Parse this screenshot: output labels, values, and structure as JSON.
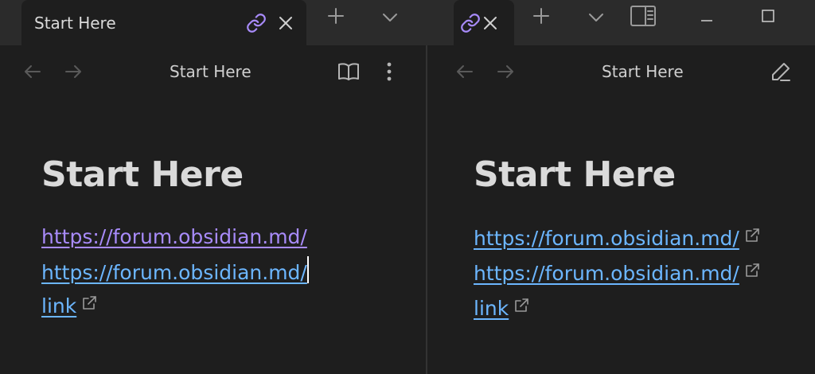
{
  "colors": {
    "bg": "#1e1e1e",
    "tabstrip": "#2b2b2b",
    "accent": "#a88bfa",
    "link": "#6cb6ff",
    "text": "#dadada",
    "muted": "#8a8a8a"
  },
  "tabs": [
    {
      "label": "Start Here",
      "icon": "link-icon",
      "close": "close-icon"
    },
    {
      "label": "",
      "icon": "link-icon",
      "close": "close-icon"
    }
  ],
  "strip_buttons": [
    "new-tab-icon",
    "tab-list-chevron-icon",
    "sidebar-toggle-icon",
    "minimize-icon",
    "maximize-icon"
  ],
  "left_pane": {
    "title": "Start Here",
    "mode": "editing",
    "actions": [
      "reading-view-icon",
      "more-options-icon"
    ],
    "heading": "Start Here",
    "links": [
      {
        "text": "https://forum.obsidian.md/",
        "external_icon": false,
        "hover": true
      },
      {
        "text": "https://forum.obsidian.md/",
        "external_icon": false,
        "cursor": true
      },
      {
        "text": "link",
        "external_icon": true
      }
    ]
  },
  "right_pane": {
    "title": "Start Here",
    "mode": "reading",
    "actions": [
      "edit-icon"
    ],
    "heading": "Start Here",
    "links": [
      {
        "text": "https://forum.obsidian.md/",
        "external_icon": true
      },
      {
        "text": "https://forum.obsidian.md/",
        "external_icon": true
      },
      {
        "text": "link",
        "external_icon": true
      }
    ]
  }
}
